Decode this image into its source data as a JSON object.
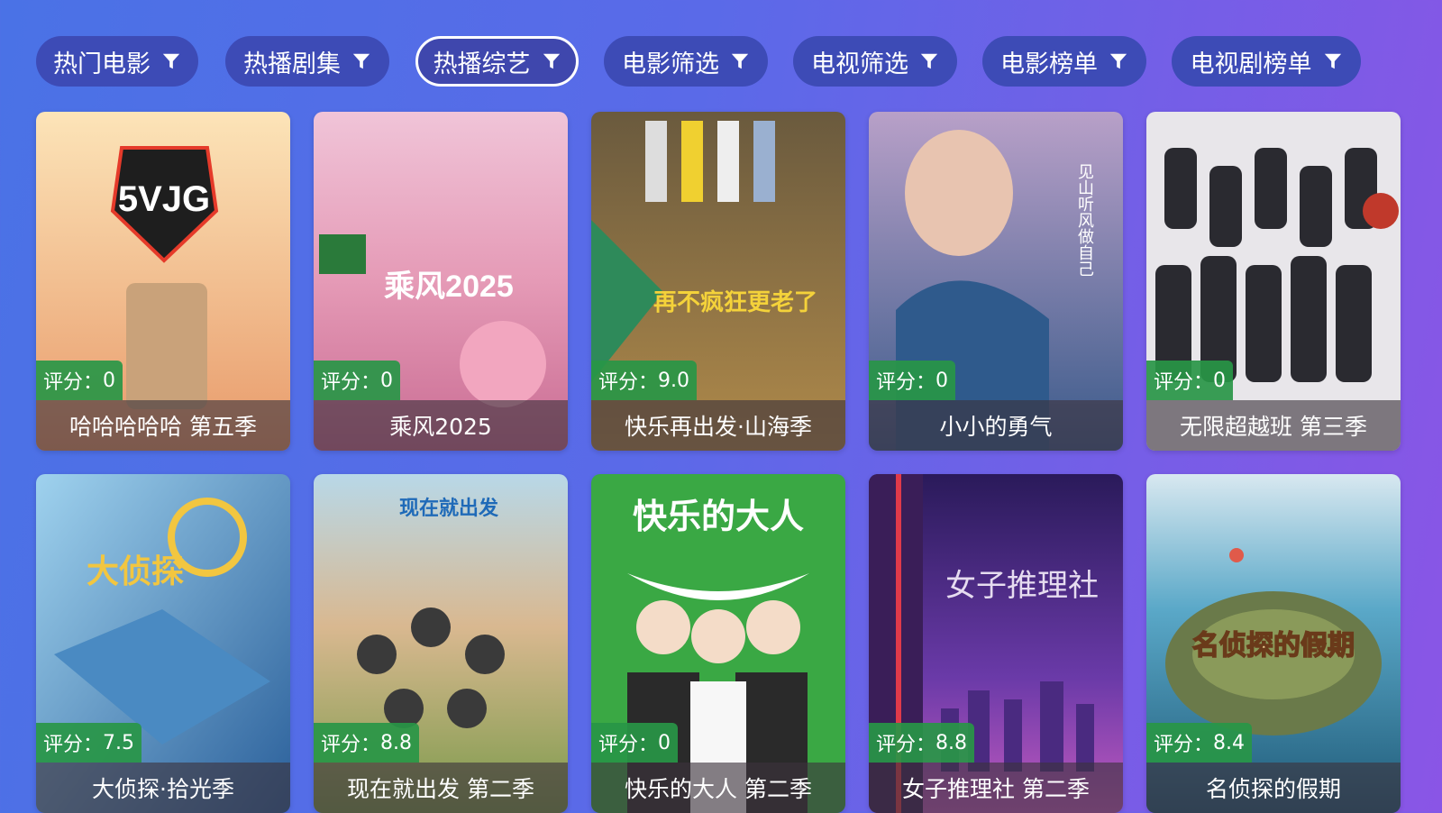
{
  "tabs": [
    {
      "label": "热门电影",
      "active": false
    },
    {
      "label": "热播剧集",
      "active": false
    },
    {
      "label": "热播综艺",
      "active": true
    },
    {
      "label": "电影筛选",
      "active": false
    },
    {
      "label": "电视筛选",
      "active": false
    },
    {
      "label": "电影榜单",
      "active": false
    },
    {
      "label": "电视剧榜单",
      "active": false
    }
  ],
  "rating_prefix": "评分：",
  "cards": [
    {
      "title": "哈哈哈哈哈 第五季",
      "rating": "0",
      "poster_text": "5VJG",
      "poster_color": "#e8a070"
    },
    {
      "title": "乘风2025",
      "rating": "0",
      "poster_text": "乘风2025",
      "poster_color": "#d78fb3"
    },
    {
      "title": "快乐再出发·山海季",
      "rating": "9.0",
      "poster_text": "再不疯狂更老了",
      "poster_color": "#8a6a3a"
    },
    {
      "title": "小小的勇气",
      "rating": "0",
      "poster_text": "见山听风做自己",
      "poster_color": "#5a6fa0"
    },
    {
      "title": "无限超越班 第三季",
      "rating": "0",
      "poster_text": "",
      "poster_color": "#4f4a52"
    },
    {
      "title": "大侦探·拾光季",
      "rating": "7.5",
      "poster_text": "大侦探",
      "poster_color": "#3e7fb8"
    },
    {
      "title": "现在就出发 第二季",
      "rating": "8.8",
      "poster_text": "现在就出发",
      "poster_color": "#c9a070"
    },
    {
      "title": "快乐的大人 第二季",
      "rating": "0",
      "poster_text": "快乐的大人",
      "poster_color": "#3aa844"
    },
    {
      "title": "女子推理社 第二季",
      "rating": "8.8",
      "poster_text": "女子推理社",
      "poster_color": "#4a2a7a"
    },
    {
      "title": "名侦探的假期",
      "rating": "8.4",
      "poster_text": "名侦探的假期",
      "poster_color": "#3f8aa8"
    }
  ],
  "colors": {
    "tab_bg": "#3d4bb6",
    "rating_bg": "#2a9a48",
    "accent": "#ffffff"
  }
}
